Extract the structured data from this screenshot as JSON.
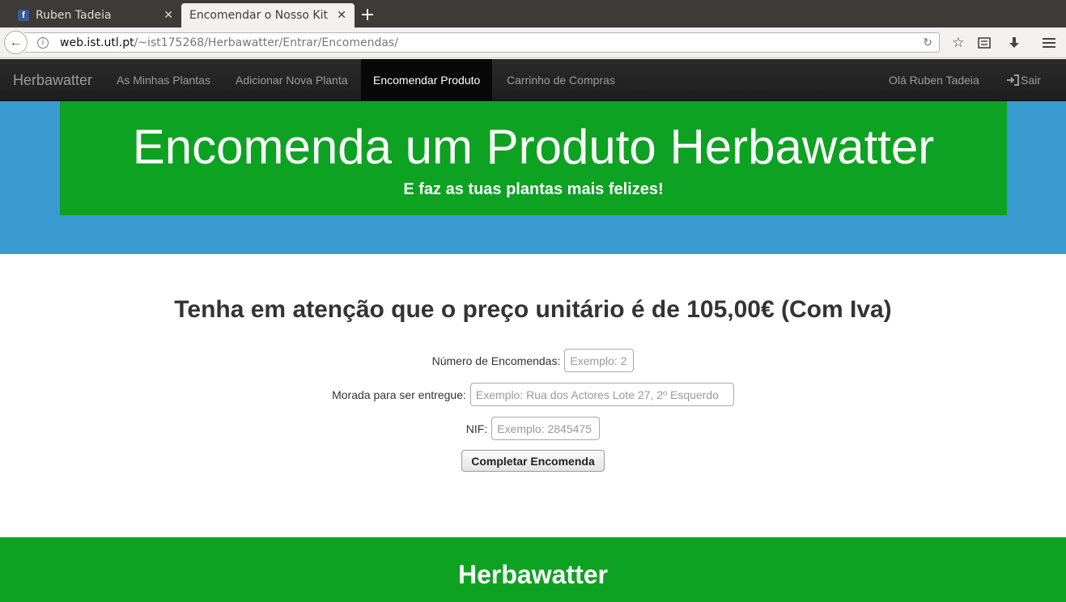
{
  "browser": {
    "tabs": [
      {
        "title": "Ruben Tadeia",
        "favicon": "facebook-icon",
        "active": false
      },
      {
        "title": "Encomendar o Nosso Kit",
        "active": true
      }
    ],
    "url_host": "web.ist.utl.pt",
    "url_path": "/~ist175268/Herbawatter/Entrar/Encomendas/"
  },
  "navbar": {
    "brand": "Herbawatter",
    "links": [
      {
        "label": "As Minhas Plantas"
      },
      {
        "label": "Adicionar Nova Planta"
      },
      {
        "label": "Encomendar Produto",
        "active": true
      },
      {
        "label": "Carrinho de Compras"
      }
    ],
    "greeting": "Olá Ruben Tadeia",
    "logout_label": "Sair"
  },
  "hero": {
    "title": "Encomenda um Produto Herbawatter",
    "subtitle": "E faz as tuas plantas mais felizes!"
  },
  "order_form": {
    "notice": "Tenha em atenção que o preço unitário é de 105,00€ (Com Iva)",
    "quantity_label": "Número de Encomendas:",
    "quantity_placeholder": "Exemplo: 2",
    "address_label": "Morada para ser entregue:",
    "address_placeholder": "Exemplo: Rua dos Actores Lote 27, 2º Esquerdo",
    "nif_label": "NIF:",
    "nif_placeholder": "Exemplo: 2845475",
    "submit_label": "Completar Encomenda"
  },
  "footer": {
    "title": "Herbawatter"
  },
  "colors": {
    "accent_green": "#0da221",
    "hero_blue": "#3a9bd0",
    "navbar_dark": "#222222"
  }
}
